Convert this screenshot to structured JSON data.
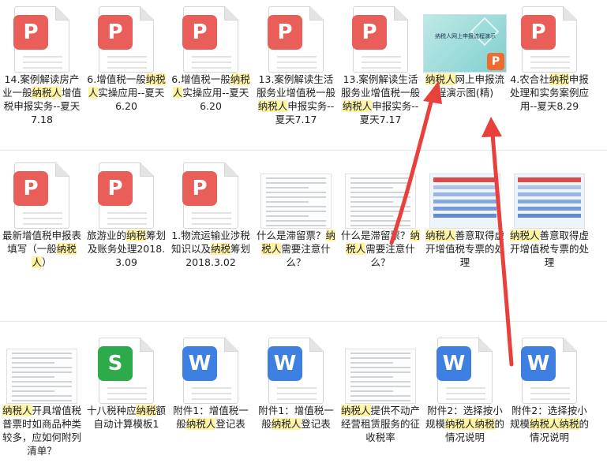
{
  "rows": [
    [
      {
        "type": "pdf",
        "icon": "pdf-icon",
        "label": [
          "14.案例解读房产业一般",
          "纳税人",
          "增值税申报实务--夏天7.18"
        ]
      },
      {
        "type": "pdf",
        "icon": "pdf-icon",
        "label": [
          "6.增值税一般",
          "纳税人",
          "实操应用--夏天6.20"
        ]
      },
      {
        "type": "pdf",
        "icon": "pdf-icon",
        "label": [
          "6.增值税一般",
          "纳税人",
          "实操应用--夏天6.20"
        ]
      },
      {
        "type": "pdf",
        "icon": "pdf-icon",
        "label": [
          "13.案例解读生活服务业增值税一般",
          "纳税人",
          "申报实务--夏天7.17"
        ]
      },
      {
        "type": "pdf",
        "icon": "pdf-icon",
        "label": [
          "13.案例解读生活服务业增值税一般",
          "纳税人",
          "申报实务--夏天7.17"
        ]
      },
      {
        "type": "ppt",
        "icon": "ppt-thumbnail-icon",
        "thumb_title": "纳税人网上申报流程演示",
        "badge": "P",
        "label": [
          "",
          "纳税人",
          "网上申报流程演示图(精)"
        ]
      },
      {
        "type": "pdf",
        "icon": "pdf-icon",
        "label": [
          "4.农合社",
          "纳税",
          "申报处理和实务案例应用--夏天8.29"
        ]
      }
    ],
    [
      {
        "type": "pdf",
        "icon": "pdf-icon",
        "label": [
          "最新增值税申报表填写（一般",
          "纳税人",
          "）"
        ]
      },
      {
        "type": "pdf",
        "icon": "pdf-icon",
        "label": [
          "旅游业的",
          "纳税",
          "筹划及账务处理2018.3.09"
        ]
      },
      {
        "type": "pdf",
        "icon": "pdf-icon",
        "label": [
          "1.物流运输业涉税知识以及",
          "纳税",
          "筹划2018.3.02"
        ]
      },
      {
        "type": "thumb",
        "icon": "document-thumbnail-icon",
        "label": [
          "什么是滞留票？",
          "纳税人",
          "需要注意什么？"
        ]
      },
      {
        "type": "thumb",
        "icon": "document-thumbnail-icon",
        "label": [
          "什么是滞留票？",
          "纳税人",
          "需要注意什么？"
        ]
      },
      {
        "type": "banner",
        "icon": "document-thumbnail-icon",
        "label": [
          "",
          "纳税人",
          "善意取得虚开增值税专票的处理"
        ]
      },
      {
        "type": "banner",
        "icon": "document-thumbnail-icon",
        "label": [
          "",
          "纳税人",
          "善意取得虚开增值税专票的处理"
        ]
      }
    ],
    [
      {
        "type": "thumb",
        "icon": "document-thumbnail-icon",
        "label": [
          "",
          "纳税人",
          "开具增值税普票时如商品种类较多，应如何附列清单？"
        ]
      },
      {
        "type": "xls",
        "icon": "spreadsheet-icon",
        "badge": "S",
        "label": [
          "十八税种应",
          "纳税",
          "额自动计算模板1"
        ]
      },
      {
        "type": "doc",
        "icon": "word-icon",
        "badge": "W",
        "label": [
          "附件1：增值税一般",
          "纳税人",
          "登记表"
        ]
      },
      {
        "type": "doc",
        "icon": "word-icon",
        "badge": "W",
        "label": [
          "附件1：增值税一般",
          "纳税人",
          "登记表"
        ]
      },
      {
        "type": "thumb",
        "icon": "document-thumbnail-icon",
        "label": [
          "",
          "纳税人",
          "提供不动产经营租赁服务的征收税率"
        ]
      },
      {
        "type": "doc",
        "icon": "word-icon",
        "badge": "W",
        "label": [
          "附件2：选择按小规模",
          "纳税人纳税",
          "的情况说明"
        ]
      },
      {
        "type": "doc",
        "icon": "word-icon",
        "badge": "W",
        "label": [
          "附件2：选择按小规模",
          "纳税人纳税",
          "的情况说明"
        ]
      }
    ]
  ],
  "pdf_badge": "P",
  "colors": {
    "highlight": "#fff3a6",
    "arrow": "#e8403a"
  }
}
